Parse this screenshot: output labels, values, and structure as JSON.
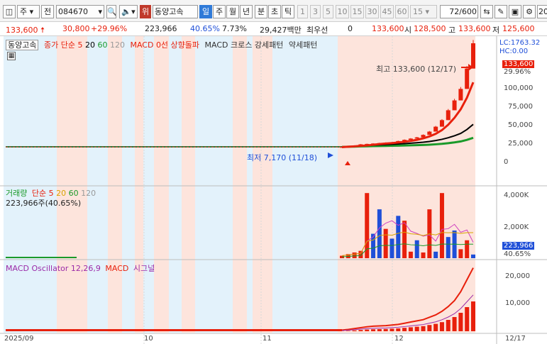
{
  "toolbar": {
    "dropdown_type": "주",
    "label_jeon": "전",
    "code": "084670",
    "wi": "위",
    "stock_name": "동양고속",
    "periods": [
      "일",
      "주",
      "월",
      "년",
      "분",
      "초",
      "틱"
    ],
    "active_period": "일",
    "numbers": [
      "1",
      "3",
      "5",
      "10",
      "15",
      "30",
      "45",
      "60"
    ],
    "interval": "15",
    "count": "72",
    "count_total": "/600",
    "zoom": "20"
  },
  "quote": {
    "price": "133,600",
    "change": "30,800",
    "pct": "+29.96%",
    "volume": "223,966",
    "vol_ratio": "40.65%",
    "turnover": "7.73%",
    "amount": "29,427백만",
    "best_label": "최우선",
    "best_val": "0",
    "ask": "133,600",
    "open_label": "시",
    "open": "128,500",
    "high_label": "고",
    "high": "133,600",
    "low_label": "저",
    "low": "125,600"
  },
  "price_pane": {
    "legend": {
      "name": "동양고속",
      "ma": "종가 단순 5",
      "ma2": "20",
      "ma3": "60",
      "ma4": "120",
      "macd_line": "MACD 0선 상향돌파",
      "macd_cross": "MACD 크로스 강세패턴",
      "weak": "약세패턴"
    },
    "high_ann": "최고 133,600 (12/17)",
    "low_ann": "최저 7,170 (11/18)",
    "lc": "LC:1763.32",
    "hc": "HC:0.00",
    "price_tag": "133,600",
    "pct_tag": "29.96%",
    "ticks": [
      "100,000",
      "75,000",
      "50,000",
      "25,000",
      "0"
    ]
  },
  "vol_pane": {
    "legend": {
      "name": "거래량",
      "ma": "단순 5",
      "m20": "20",
      "m60": "60",
      "m120": "120"
    },
    "cur": "223,966주(40.65%)",
    "ticks": [
      "4,000K",
      "2,000K"
    ],
    "vol_tag": "223,966",
    "pct_tag": "40.65%"
  },
  "osc_pane": {
    "legend": {
      "name": "MACD Oscillator 12,26,9",
      "macd": "MACD",
      "signal": "시그널"
    },
    "ticks": [
      "20,000",
      "10,000"
    ]
  },
  "x_axis": {
    "labels": [
      "2025/09",
      "10",
      "11",
      "12",
      "12/17"
    ]
  },
  "colors": {
    "accent": "#2f7ad8",
    "up": "#e8200c",
    "down": "#1f4fd8",
    "shade_red": "#fde4dc",
    "shade_blue": "#e3f2fb"
  },
  "chart_data": {
    "type": "bar",
    "x": [
      "11/18",
      "11/19",
      "11/20",
      "11/21",
      "11/24",
      "11/25",
      "11/26",
      "11/27",
      "11/28",
      "12/01",
      "12/02",
      "12/03",
      "12/04",
      "12/05",
      "12/08",
      "12/09",
      "12/10",
      "12/11",
      "12/12",
      "12/15",
      "12/16",
      "12/17"
    ],
    "close": [
      7170,
      8000,
      9000,
      10500,
      11000,
      11500,
      12000,
      12500,
      13000,
      14500,
      16000,
      17500,
      19000,
      22000,
      26000,
      32000,
      40000,
      52000,
      64000,
      78000,
      102800,
      133600
    ],
    "volume_k": [
      150,
      250,
      350,
      450,
      4000,
      1500,
      3000,
      1800,
      1200,
      2600,
      2300,
      400,
      1100,
      350,
      3000,
      400,
      4000,
      1300,
      1700,
      550,
      1100,
      224
    ],
    "volume_up": [
      true,
      true,
      true,
      true,
      true,
      false,
      false,
      true,
      false,
      false,
      true,
      true,
      false,
      true,
      true,
      false,
      true,
      false,
      false,
      true,
      true,
      false
    ],
    "macd_osc": [
      50,
      150,
      300,
      450,
      600,
      700,
      750,
      800,
      900,
      1000,
      1200,
      1400,
      1600,
      1800,
      2200,
      2600,
      3200,
      4000,
      5000,
      6500,
      8500,
      10500
    ],
    "ylim_price": [
      -15000,
      133600
    ],
    "ylim_volume_k": [
      0,
      4400
    ],
    "ylim_osc": [
      -500,
      24000
    ]
  }
}
